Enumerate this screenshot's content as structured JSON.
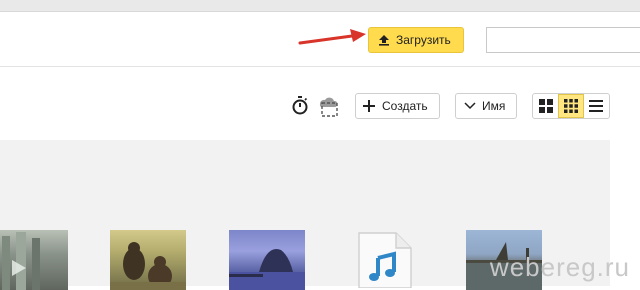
{
  "header": {
    "upload_label": "Загрузить",
    "search_placeholder": ""
  },
  "toolbar": {
    "create_label": "Создать",
    "sort_label": "Имя",
    "icons": [
      "timer-icon",
      "cloud-select-icon",
      "plus-icon",
      "chevron-down-icon",
      "view-large-tiles-icon",
      "view-small-tiles-icon",
      "view-list-icon"
    ],
    "active_view": "view-small-tiles"
  },
  "files": [
    {
      "type": "image",
      "icon": "photo-thumbnail"
    },
    {
      "type": "image",
      "icon": "photo-thumbnail"
    },
    {
      "type": "image",
      "icon": "photo-thumbnail"
    },
    {
      "type": "audio",
      "icon": "music-file-icon"
    },
    {
      "type": "image",
      "icon": "photo-thumbnail"
    }
  ],
  "watermark": "webereg.ru",
  "colors": {
    "accent_yellow": "#ffdb4d",
    "arrow_red": "#d9342a",
    "music_icon_blue": "#2f87c8"
  }
}
